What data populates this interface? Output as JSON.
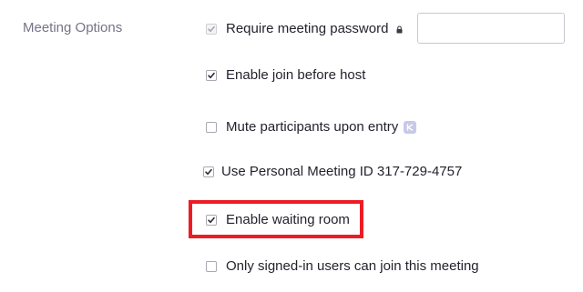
{
  "section": {
    "label": "Meeting Options"
  },
  "options": [
    {
      "label": "Require meeting password",
      "checked": true,
      "disabled": true,
      "icon": "lock-icon"
    },
    {
      "label": "Enable join before host",
      "checked": true,
      "disabled": false
    },
    {
      "label": "Mute participants upon entry",
      "checked": false,
      "disabled": false,
      "icon": "locked-setting-badge-icon"
    },
    {
      "label": "Use Personal Meeting ID 317-729-4757",
      "checked": true,
      "disabled": false
    },
    {
      "label": "Enable waiting room",
      "checked": true,
      "disabled": false,
      "highlighted": true
    },
    {
      "label": "Only signed-in users can join this meeting",
      "checked": false,
      "disabled": false
    }
  ],
  "password_field": {
    "value": "",
    "placeholder": ""
  },
  "colors": {
    "highlight": "#ed1c24",
    "section_label": "#747487",
    "text": "#23232e",
    "badge": "#c7c9e8"
  }
}
